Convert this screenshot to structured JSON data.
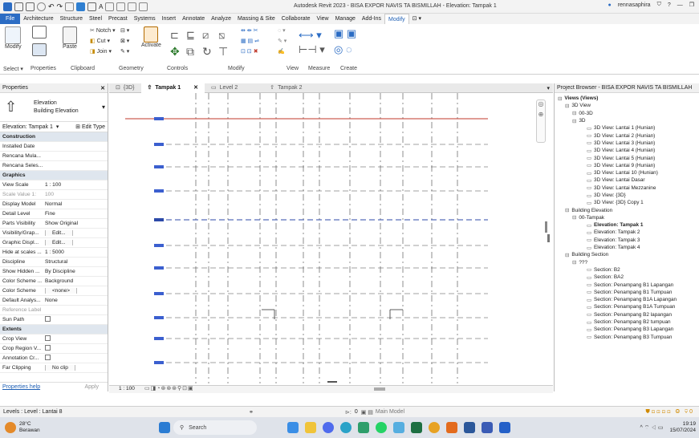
{
  "titlebar": {
    "title": "Autodesk Revit 2023 - BISA EXPOR NAVIS TA BISMILLAH - Elevation: Tampak 1",
    "user": "rennasaphira"
  },
  "ribbon_tabs": [
    "File",
    "Architecture",
    "Structure",
    "Steel",
    "Precast",
    "Systems",
    "Insert",
    "Annotate",
    "Analyze",
    "Massing & Site",
    "Collaborate",
    "View",
    "Manage",
    "Add-Ins",
    "Modify"
  ],
  "ribbon": {
    "modify": "Modify",
    "paste": "Paste",
    "notch": "Notch",
    "cut": "Cut",
    "join": "Join",
    "activate": "Activate",
    "groups": {
      "select": "Select",
      "properties": "Properties",
      "clipboard": "Clipboard",
      "geometry": "Geometry",
      "controls": "Controls",
      "modify": "Modify",
      "view": "View",
      "measure": "Measure",
      "create": "Create"
    }
  },
  "properties": {
    "header": "Properties",
    "family": "Elevation",
    "type": "Building Elevation",
    "selector": "Elevation: Tampak 1",
    "edit_type": "Edit Type",
    "rows": [
      {
        "k": "Construction",
        "v": "",
        "group": true
      },
      {
        "k": "Installed Date",
        "v": ""
      },
      {
        "k": "Rencana Mula...",
        "v": ""
      },
      {
        "k": "Rencana Seles...",
        "v": ""
      },
      {
        "k": "Graphics",
        "v": "",
        "group": true
      },
      {
        "k": "View Scale",
        "v": "1 : 100"
      },
      {
        "k": "Scale Value   1:",
        "v": "100",
        "dim": true
      },
      {
        "k": "Display Model",
        "v": "Normal"
      },
      {
        "k": "Detail Level",
        "v": "Fine"
      },
      {
        "k": "Parts Visibility",
        "v": "Show Original"
      },
      {
        "k": "Visibility/Grap...",
        "v": "Edit...",
        "btn": true
      },
      {
        "k": "Graphic Displ...",
        "v": "Edit...",
        "btn": true
      },
      {
        "k": "Hide at scales ...",
        "v": "1 : 5000"
      },
      {
        "k": "Discipline",
        "v": "Structural"
      },
      {
        "k": "Show Hidden ...",
        "v": "By Discipline"
      },
      {
        "k": "Color Scheme ...",
        "v": "Background"
      },
      {
        "k": "Color Scheme",
        "v": "<none>",
        "btn": true
      },
      {
        "k": "Default Analys...",
        "v": "None"
      },
      {
        "k": "Reference Label",
        "v": "",
        "dim": true
      },
      {
        "k": "Sun Path",
        "v": "",
        "chk": true
      },
      {
        "k": "Extents",
        "v": "",
        "group": true
      },
      {
        "k": "Crop View",
        "v": "",
        "chk": true
      },
      {
        "k": "Crop Region V...",
        "v": "",
        "chk": true
      },
      {
        "k": "Annotation Cr...",
        "v": "",
        "chk": true
      },
      {
        "k": "Far Clipping",
        "v": "No clip",
        "btn": true
      }
    ],
    "help": "Properties help",
    "apply": "Apply"
  },
  "view_tabs": [
    {
      "label": "{3D}"
    },
    {
      "label": "Tampak 1",
      "active": true
    },
    {
      "label": "Level 2"
    },
    {
      "label": "Tampak 2"
    }
  ],
  "viewbar": {
    "scale": "1 : 100"
  },
  "browser": {
    "header": "Project Browser - BISA EXPOR NAVIS TA BISMILLAH",
    "items": [
      {
        "t": "Views (Views)",
        "d": 0,
        "b": true
      },
      {
        "t": "3D View",
        "d": 1
      },
      {
        "t": "00-3D",
        "d": 2
      },
      {
        "t": "3D",
        "d": 2
      },
      {
        "t": "3D View: Lantai 1 (Hunian)",
        "d": 4
      },
      {
        "t": "3D View: Lantai 2 (Hunian)",
        "d": 4
      },
      {
        "t": "3D View: Lantai 3 (Hunian)",
        "d": 4
      },
      {
        "t": "3D View: Lantai 4 (Hunian)",
        "d": 4
      },
      {
        "t": "3D View: Lantai 5 (Hunian)",
        "d": 4
      },
      {
        "t": "3D View: Lantai 9 (Hunian)",
        "d": 4
      },
      {
        "t": "3D View: Lantai 10 (Hunian)",
        "d": 4
      },
      {
        "t": "3D View: Lantai Dasar",
        "d": 4
      },
      {
        "t": "3D View: Lantai Mezzanine",
        "d": 4
      },
      {
        "t": "3D View: {3D}",
        "d": 4
      },
      {
        "t": "3D View: {3D} Copy 1",
        "d": 4
      },
      {
        "t": "Building Elevation",
        "d": 1
      },
      {
        "t": "00-Tampak",
        "d": 2
      },
      {
        "t": "Elevation: Tampak 1",
        "d": 4,
        "b": true
      },
      {
        "t": "Elevation: Tampak 2",
        "d": 4
      },
      {
        "t": "Elevation: Tampak 3",
        "d": 4
      },
      {
        "t": "Elevation: Tampak 4",
        "d": 4
      },
      {
        "t": "Building Section",
        "d": 1
      },
      {
        "t": "???",
        "d": 2
      },
      {
        "t": "Section: B2",
        "d": 4
      },
      {
        "t": "Section: BA2",
        "d": 4
      },
      {
        "t": "Section: Penampang B1 Lapangan",
        "d": 4
      },
      {
        "t": "Section: Penampang B1 Tumpuan",
        "d": 4
      },
      {
        "t": "Section: Penampang B1A Lapangan",
        "d": 4
      },
      {
        "t": "Section: Penampang B1A Tumpuan",
        "d": 4
      },
      {
        "t": "Section: Penampang B2 lapangan",
        "d": 4
      },
      {
        "t": "Section: Penampang B2 tumpuan",
        "d": 4
      },
      {
        "t": "Section: Penampang B3 Lapangan",
        "d": 4
      },
      {
        "t": "Section: Penampang B3 Tumpuan",
        "d": 4
      }
    ]
  },
  "statusbar": {
    "level": "Levels : Level : Lantai 8",
    "zero": "0",
    "model": "Main Model"
  },
  "taskbar": {
    "temp": "28°C",
    "weather": "Berawan",
    "search": "Search",
    "time": "19:19",
    "date": "15/07/2024"
  },
  "colors": {
    "accent": "#2b6cc4",
    "level_red": "#c0392b",
    "level_blue": "#2c4aa8",
    "ribbon_group": "#dfe6ee"
  }
}
